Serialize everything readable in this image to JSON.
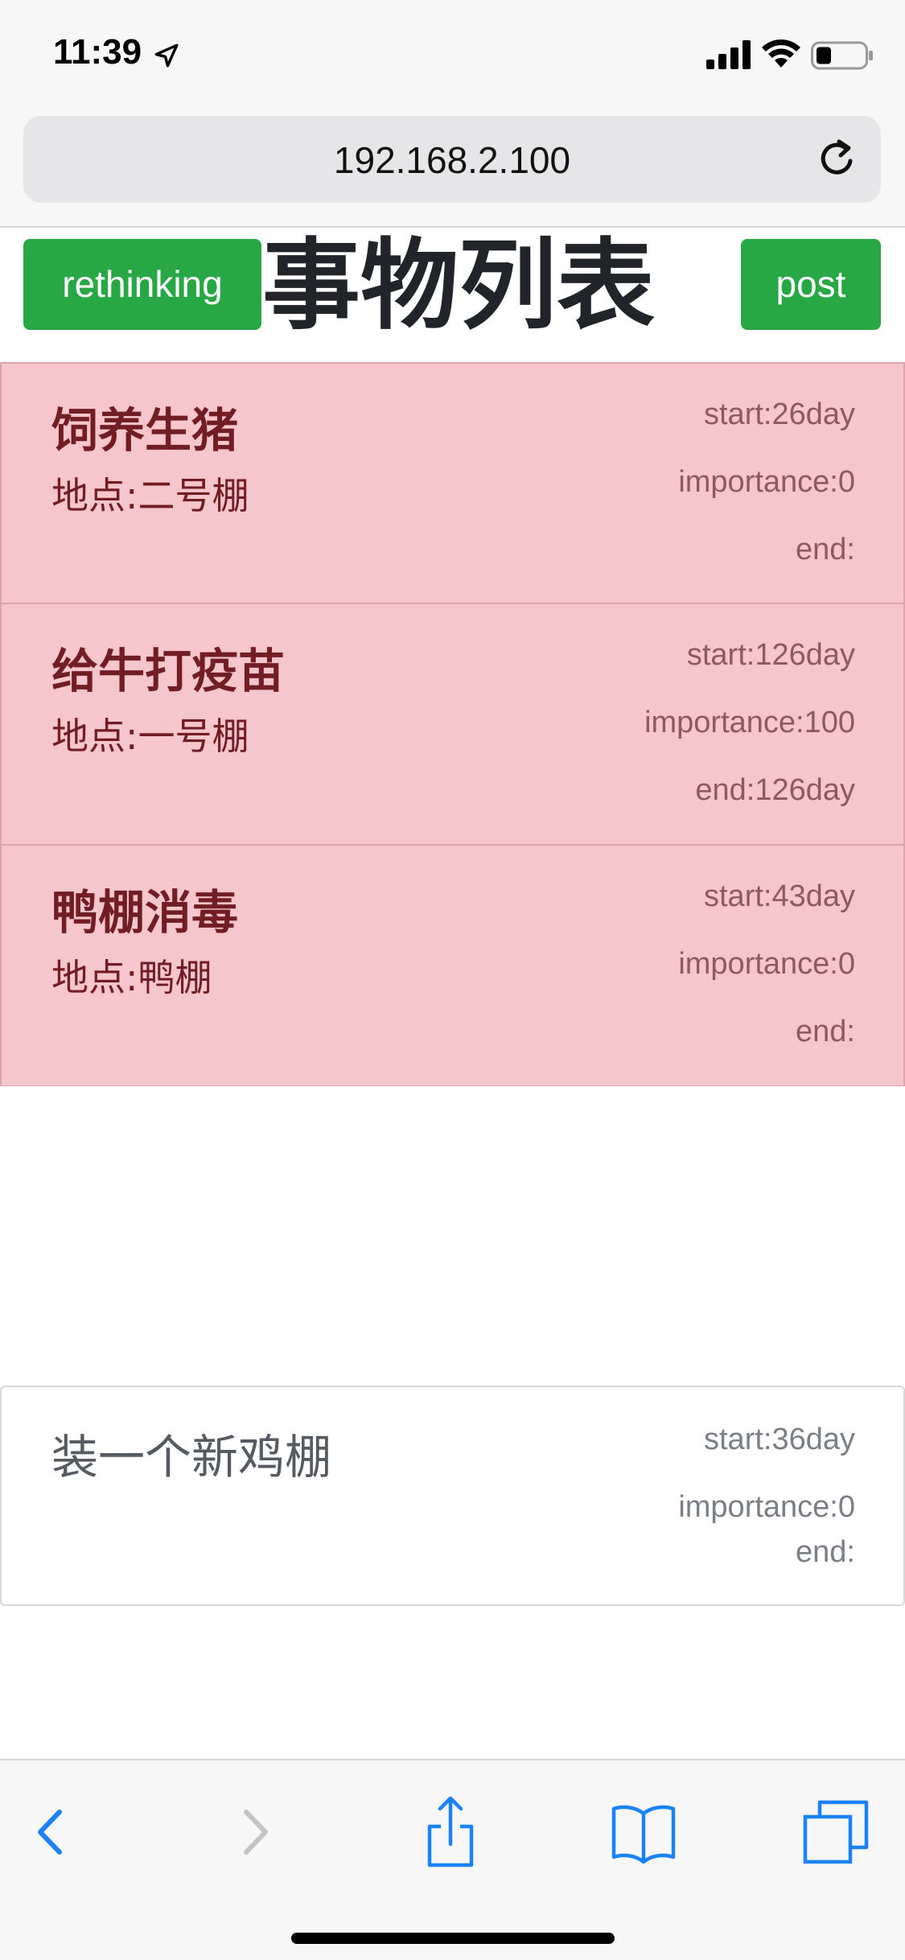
{
  "status_bar": {
    "time": "11:39",
    "icons": [
      "location-arrow-icon",
      "cellular-signal-icon",
      "wifi-icon",
      "battery-icon"
    ]
  },
  "browser": {
    "url": "192.168.2.100",
    "toolbar_icons": [
      "back-icon",
      "forward-icon",
      "share-icon",
      "bookmarks-icon",
      "tabs-icon"
    ]
  },
  "header": {
    "left_button": "rethinking",
    "title": "事物列表",
    "right_button": "post"
  },
  "colors": {
    "button_green": "#28a745",
    "task_bg": "#f5c6cb",
    "task_text": "#721c24",
    "ios_blue": "#1a82fb"
  },
  "tasks": [
    {
      "title": "饲养生猪",
      "location": "地点:二号棚",
      "start": "start:26day",
      "importance": "importance:0",
      "end": "end:"
    },
    {
      "title": "给牛打疫苗",
      "location": "地点:一号棚",
      "start": "start:126day",
      "importance": "importance:100",
      "end": "end:126day"
    },
    {
      "title": "鸭棚消毒",
      "location": "地点:鸭棚",
      "start": "start:43day",
      "importance": "importance:0",
      "end": "end:"
    }
  ],
  "completed": [
    {
      "title": "装一个新鸡棚",
      "start": "start:36day",
      "importance": "importance:0",
      "end": "end:"
    }
  ]
}
